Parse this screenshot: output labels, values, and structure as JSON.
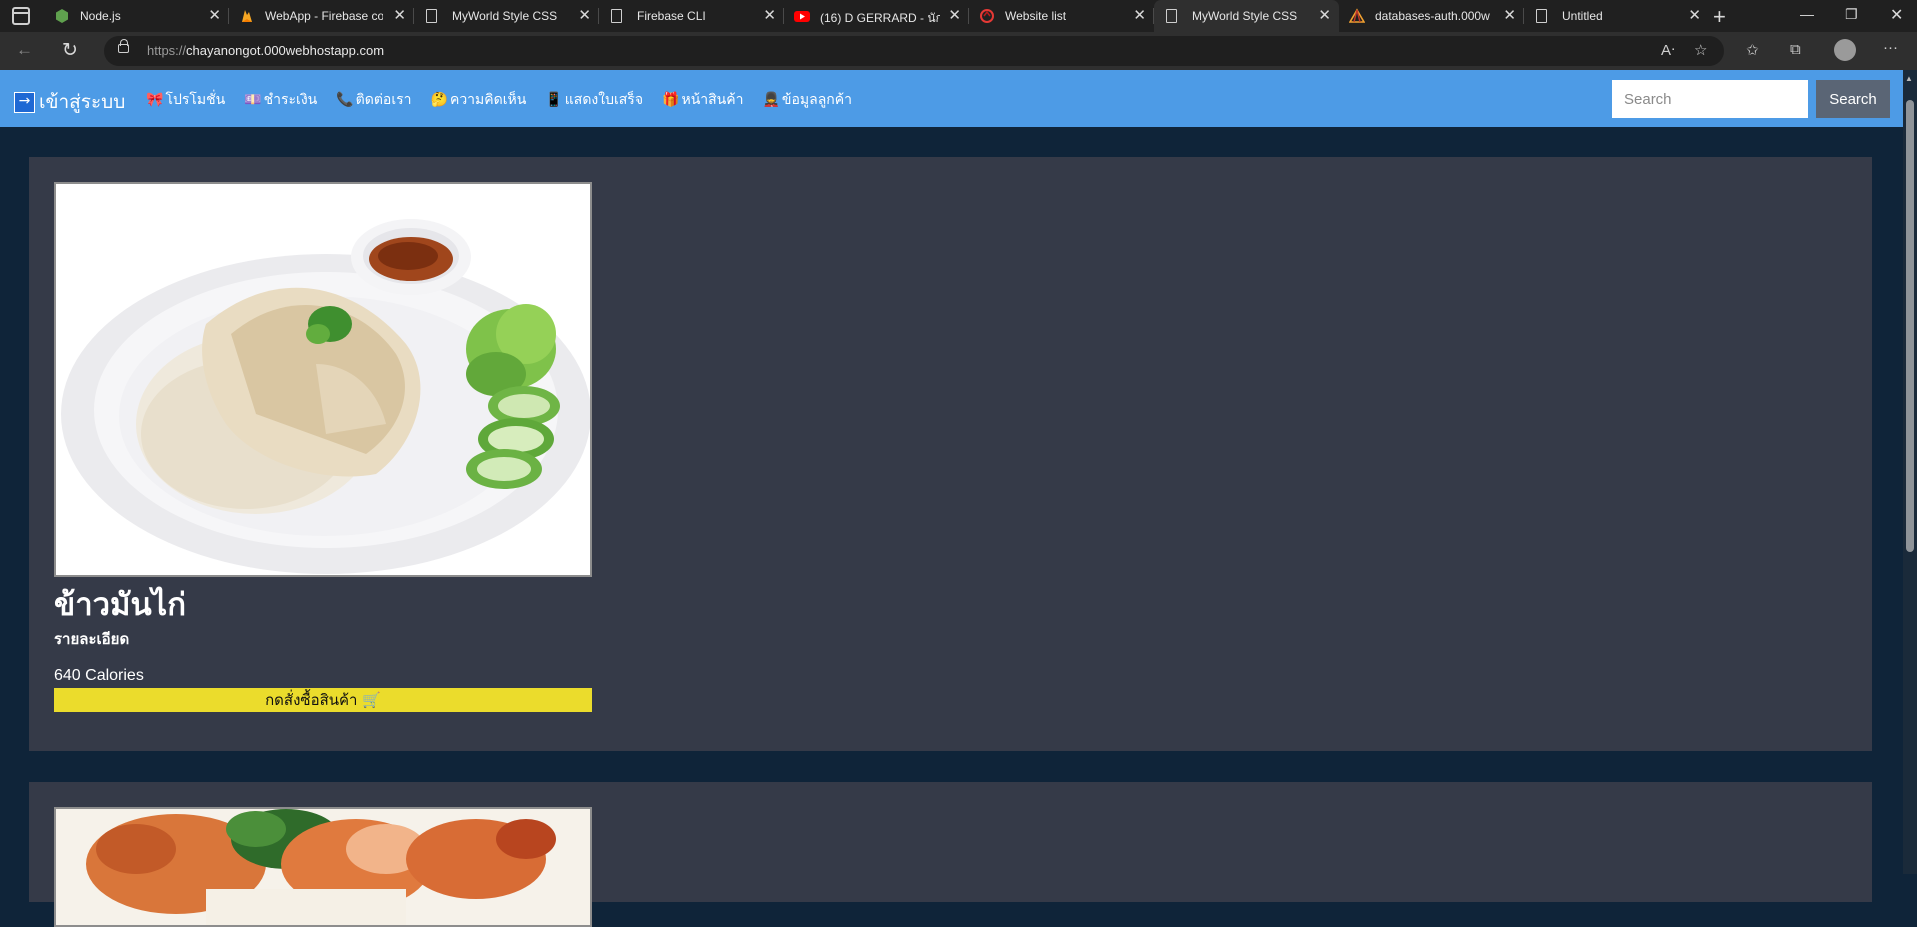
{
  "browser": {
    "tabs": [
      {
        "title": "Node.js",
        "icon": "nodejs-icon"
      },
      {
        "title": "WebApp - Firebase co",
        "icon": "firebase-icon"
      },
      {
        "title": "MyWorld Style CSS",
        "icon": "page-icon"
      },
      {
        "title": "Firebase CLI",
        "icon": "page-icon"
      },
      {
        "title": "(16) D GERRARD - นัก",
        "icon": "youtube-icon"
      },
      {
        "title": "Website list",
        "icon": "webhost-icon"
      },
      {
        "title": "MyWorld Style CSS",
        "icon": "page-icon"
      },
      {
        "title": "databases-auth.000w",
        "icon": "webhost-icon"
      },
      {
        "title": "Untitled",
        "icon": "page-icon"
      }
    ],
    "active_tab_index": 6,
    "url_protocol": "https://",
    "url_host": "chayanongot.000webhostapp.com"
  },
  "navbar": {
    "brand": "เข้าสู่ระบบ",
    "brand_icon": "→",
    "links": [
      {
        "emoji": "🎀",
        "label": "โปรโมชั่น"
      },
      {
        "emoji": "💷",
        "label": "ชำระเงิน"
      },
      {
        "emoji": "📞",
        "label": "ติดต่อเรา"
      },
      {
        "emoji": "🤔",
        "label": "ความคิดเห็น"
      },
      {
        "emoji": "📱",
        "label": "แสดงใบเสร็จ"
      },
      {
        "emoji": "🎁",
        "label": "หน้าสินค้า"
      },
      {
        "emoji": "💂",
        "label": "ข้อมูลลูกค้า"
      }
    ],
    "search_placeholder": "Search",
    "search_button": "Search",
    "color": "#4d9be6"
  },
  "products": [
    {
      "name": "ข้าวมันไก่",
      "detail": "รายละเอียด",
      "calories": "640 Calories",
      "order_label": "กดสั่งซื้อสินค้า 🛒"
    }
  ],
  "colors": {
    "page_bg": "#0f2439",
    "card_bg": "#353a48",
    "order_button": "#ebdc2c"
  }
}
